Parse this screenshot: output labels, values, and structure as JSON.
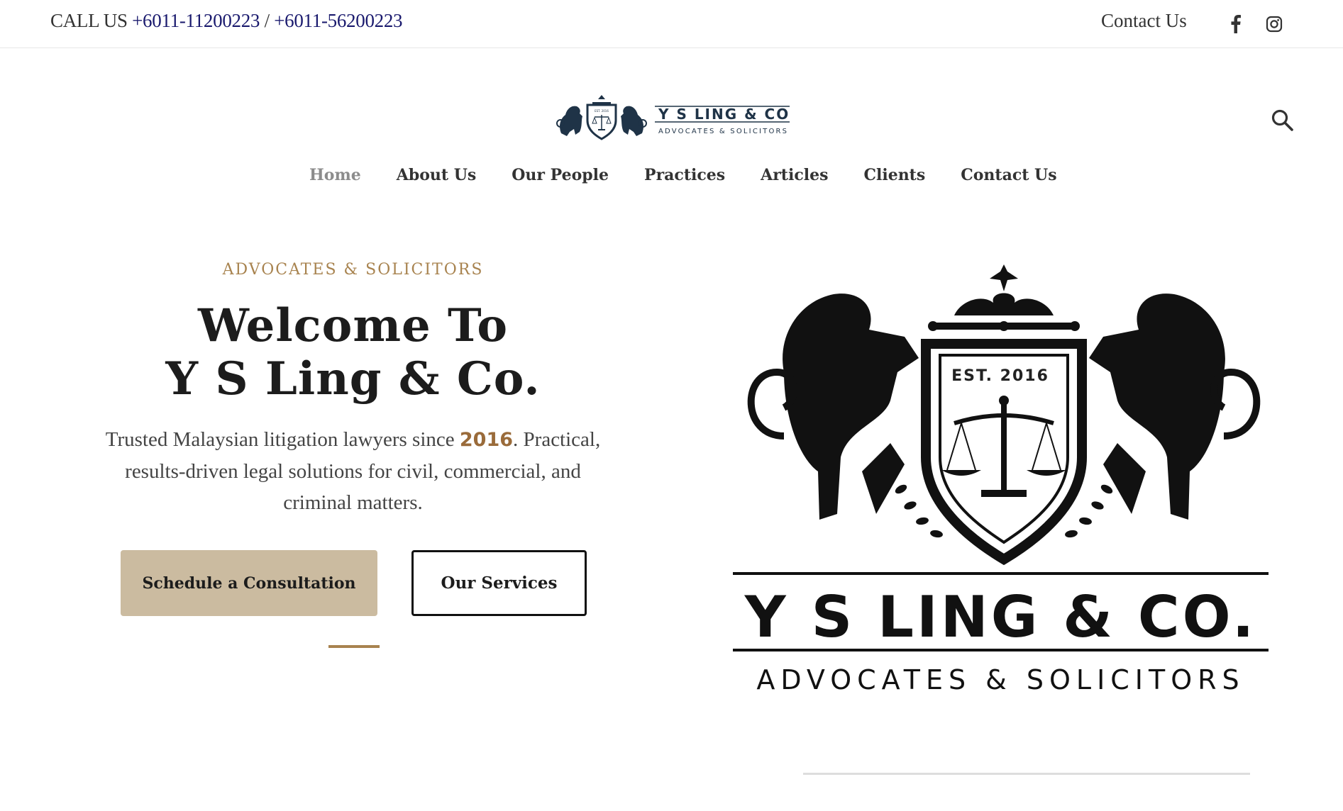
{
  "topbar": {
    "call_label": "CALL US",
    "phone_1": "+6011-11200223",
    "separator": "/",
    "phone_2": "+6011-56200223",
    "contact_link": "Contact Us",
    "social": [
      "facebook-icon",
      "instagram-icon"
    ]
  },
  "header": {
    "logo_name": "Y S LING & CO.",
    "logo_tagline": "ADVOCATES & SOLICITORS",
    "logo_est": "EST. 2016"
  },
  "nav": {
    "items": [
      {
        "label": "Home",
        "active": true
      },
      {
        "label": "About Us",
        "active": false
      },
      {
        "label": "Our People",
        "active": false
      },
      {
        "label": "Practices",
        "active": false
      },
      {
        "label": "Articles",
        "active": false
      },
      {
        "label": "Clients",
        "active": false
      },
      {
        "label": "Contact Us",
        "active": false
      }
    ]
  },
  "hero": {
    "eyebrow": "ADVOCATES & SOLICITORS",
    "title_line1": "Welcome To",
    "title_line2": "Y S Ling & Co.",
    "desc_before": "Trusted Malaysian litigation lawyers since ",
    "desc_year": "2016",
    "desc_after": ". Practical, results-driven legal solutions for civil, commercial, and criminal matters.",
    "primary_button": "Schedule a Consultation",
    "secondary_button": "Our Services"
  },
  "hero_logo": {
    "est": "EST. 2016",
    "name": "Y S LING & CO.",
    "tagline": "ADVOCATES & SOLICITORS"
  },
  "colors": {
    "accent_gold": "#a8834f",
    "button_beige": "#cbbba0",
    "phone_navy": "#1a1a6e",
    "logo_navy": "#1f3347"
  }
}
